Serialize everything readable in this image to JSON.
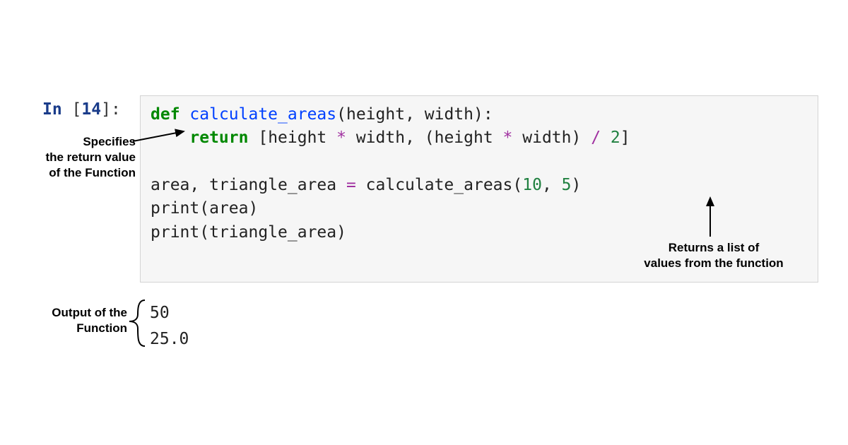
{
  "prompt": {
    "in_word": "In",
    "number": "14",
    "suffix": ":"
  },
  "code": {
    "def": "def",
    "fn_name": "calculate_areas",
    "params_open": "(",
    "param1": "height",
    "comma1": ", ",
    "param2": "width",
    "params_close": ")",
    "colon": ":",
    "return_kw": "return",
    "list_open": " [",
    "expr1a": "height ",
    "mul1": "*",
    "expr1b": " width, (height ",
    "mul2": "*",
    "expr1c": " width) ",
    "div": "/",
    "space": " ",
    "two": "2",
    "list_close": "]",
    "assign_lhs": "area, triangle_area ",
    "eq": "=",
    "assign_rhs_fn": " calculate_areas",
    "call_open": "(",
    "arg1": "10",
    "comma2": ", ",
    "arg2": "5",
    "call_close": ")",
    "print1": "print",
    "print1_arg_open": "(",
    "print1_arg": "area",
    "print1_arg_close": ")",
    "print2": "print",
    "print2_arg_open": "(",
    "print2_arg": "triangle_area",
    "print2_arg_close": ")"
  },
  "output": {
    "line1": "50",
    "line2": "25.0"
  },
  "annotations": {
    "return_label_l1": "Specifies",
    "return_label_l2": "the return value",
    "return_label_l3": "of the Function",
    "list_label_l1": "Returns a list of",
    "list_label_l2": "values from the function",
    "output_label_l1": "Output of the",
    "output_label_l2": "Function"
  }
}
